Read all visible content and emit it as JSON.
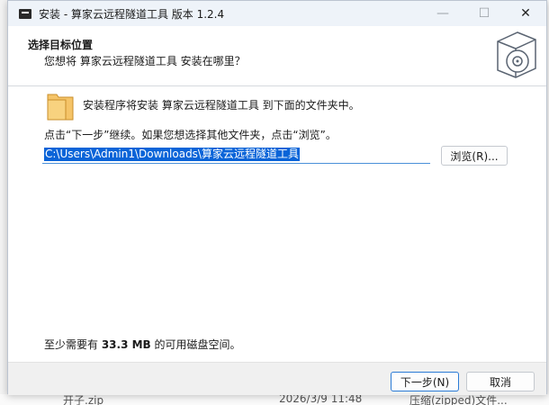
{
  "window": {
    "title": "安装 - 算家云远程隧道工具 版本 1.2.4",
    "minimize": "—",
    "maximize": "☐",
    "close": "✕"
  },
  "header": {
    "title": "选择目标位置",
    "subtitle": "您想将 算家云远程隧道工具 安装在哪里？",
    "icon": "disc-install-icon"
  },
  "body": {
    "folder_icon": "folder-icon",
    "info": "安装程序将安装 算家云远程隧道工具 到下面的文件夹中。",
    "instruction": "点击“下一步”继续。如果您想选择其他文件夹，点击“浏览”。",
    "path_value": "C:\\Users\\Admin1\\Downloads\\算家云远程隧道工具",
    "browse_label": "浏览(R)...",
    "space_prefix": "至少需要有 ",
    "space_amount": "33.3 MB",
    "space_suffix": " 的可用磁盘空间。"
  },
  "footer": {
    "next_label": "下一步(N)",
    "cancel_label": "取消"
  },
  "background": {
    "bottom_file_name": "开子.zip",
    "bottom_date": "2026/3/9 11:48",
    "bottom_type": "压缩(zipped)文件..."
  },
  "colors": {
    "accent": "#0a64d8",
    "focus_border": "#2b7bd6",
    "folder": "#f5c468"
  }
}
